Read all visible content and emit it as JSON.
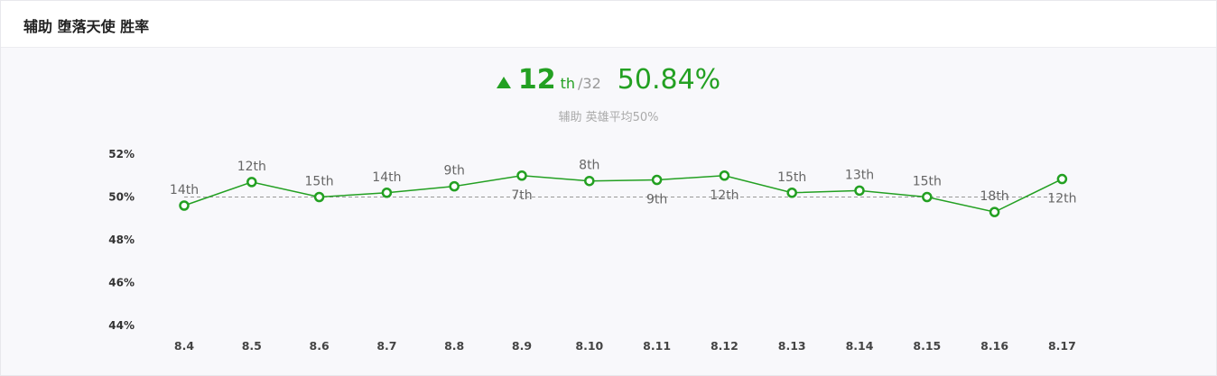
{
  "header": {
    "title": "辅助 堕落天使 胜率"
  },
  "summary": {
    "rank": "12",
    "rank_suffix": "th",
    "rank_total": "/32",
    "winrate": "50.84%",
    "average_note": "辅助 英雄平均50%"
  },
  "colors": {
    "accent": "#23a022",
    "average_line": "#999999",
    "muted_text": "#aaaaaa"
  },
  "icons": {
    "trend": "triangle-up-icon"
  },
  "chart_data": {
    "type": "line",
    "categories": [
      "8.4",
      "8.5",
      "8.6",
      "8.7",
      "8.8",
      "8.9",
      "8.10",
      "8.11",
      "8.12",
      "8.13",
      "8.14",
      "8.15",
      "8.16",
      "8.17"
    ],
    "values": [
      49.6,
      50.7,
      50.0,
      50.2,
      50.5,
      51.0,
      50.75,
      50.8,
      51.0,
      50.2,
      50.3,
      50.0,
      49.3,
      50.84
    ],
    "rank_labels": [
      "14th",
      "12th",
      "15th",
      "14th",
      "9th",
      "7th",
      "8th",
      "9th",
      "12th",
      "15th",
      "13th",
      "15th",
      "18th",
      "12th"
    ],
    "rank_label_position": [
      "above",
      "above",
      "above",
      "above",
      "above",
      "below",
      "above",
      "below",
      "below",
      "above",
      "above",
      "above",
      "above",
      "below"
    ],
    "reference_line": 50,
    "ylim": [
      44,
      52
    ],
    "y_ticks": [
      "52%",
      "50%",
      "48%",
      "46%",
      "44%"
    ],
    "y_tick_values": [
      52,
      50,
      48,
      46,
      44
    ],
    "grid": false,
    "legend": "none"
  }
}
